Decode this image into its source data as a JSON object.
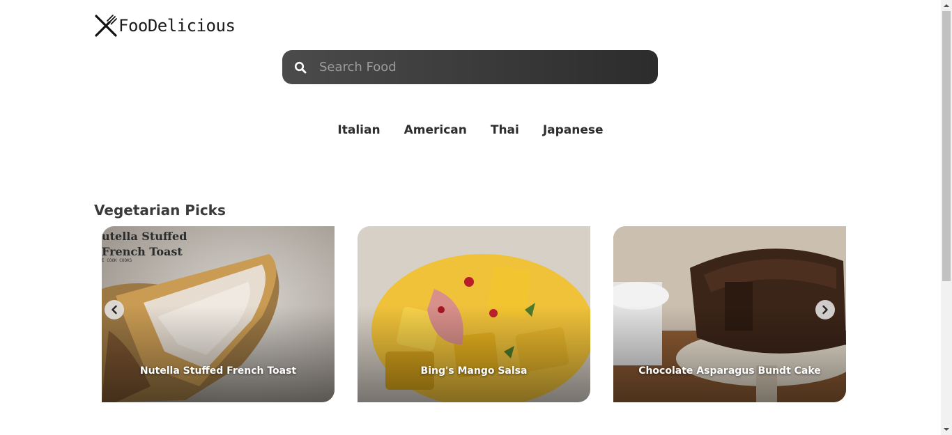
{
  "app": {
    "name": "FooDelicious"
  },
  "search": {
    "placeholder": "Search Food",
    "value": ""
  },
  "cuisines": [
    "Italian",
    "American",
    "Thai",
    "Japanese"
  ],
  "section": {
    "title": "Vegetarian Picks"
  },
  "cards": [
    {
      "title": "Nutella Stuffed French Toast",
      "image_caption": "utella Stuffed\nFrench Toast",
      "image_credit": "E COOK COOKS"
    },
    {
      "title": "Bing's Mango Salsa"
    },
    {
      "title": "Chocolate Asparagus Bundt Cake"
    }
  ],
  "icons": {
    "logo": "fork-knife-icon",
    "search": "search-icon",
    "prev": "chevron-left-icon",
    "next": "chevron-right-icon"
  },
  "colors": {
    "search_bg": "#3b3b3b",
    "text": "#2e2e2e",
    "page_bg": "#ffffff"
  }
}
